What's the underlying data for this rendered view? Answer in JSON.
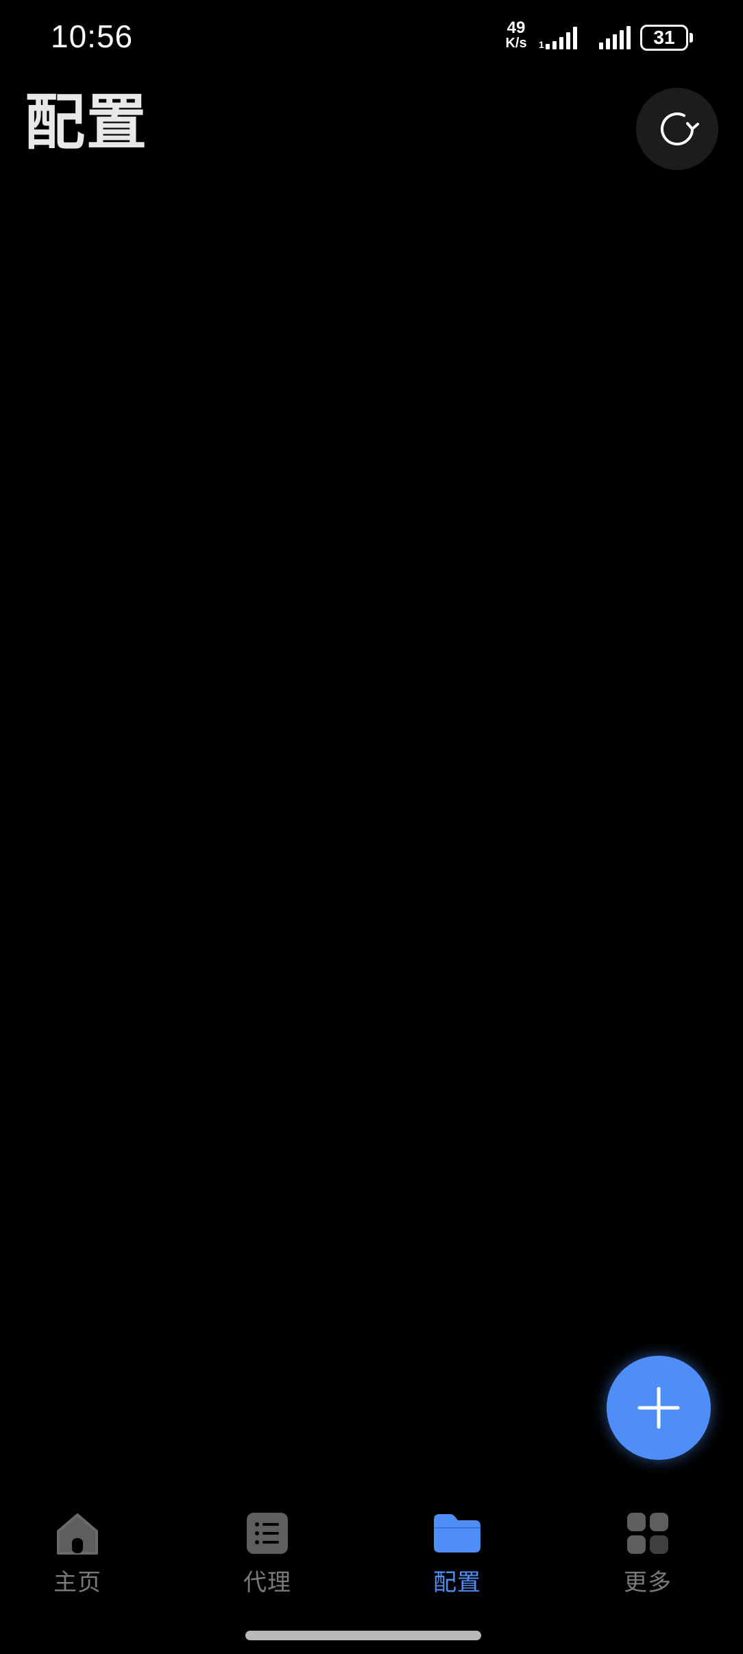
{
  "status_bar": {
    "time": "10:56",
    "net_speed_value": "49",
    "net_speed_unit": "K/s",
    "battery": "31"
  },
  "header": {
    "title": "配置"
  },
  "nav": {
    "items": [
      {
        "label": "主页",
        "icon": "home-icon"
      },
      {
        "label": "代理",
        "icon": "list-icon"
      },
      {
        "label": "配置",
        "icon": "folder-icon",
        "active": true
      },
      {
        "label": "更多",
        "icon": "grid-icon"
      }
    ]
  },
  "colors": {
    "accent": "#4f8ef7",
    "background": "#000000",
    "inactive": "#7a7a7a"
  }
}
